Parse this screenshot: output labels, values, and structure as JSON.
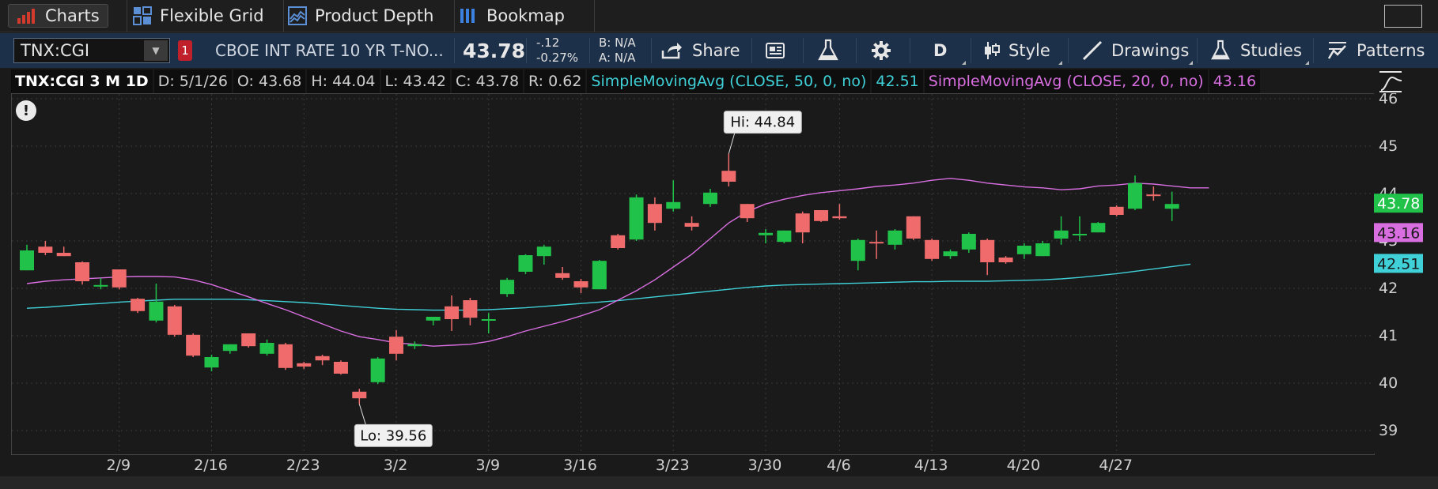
{
  "tabs": [
    {
      "label": "Charts",
      "icon": "bar-chart-icon",
      "active": true
    },
    {
      "label": "Flexible Grid",
      "icon": "grid-icon"
    },
    {
      "label": "Product Depth",
      "icon": "depth-icon"
    },
    {
      "label": "Bookmap",
      "icon": "bookmap-icon"
    }
  ],
  "toolbar": {
    "symbol": "TNX:CGI",
    "badge": "1",
    "description": "CBOE INT RATE 10 YR T-NO...",
    "last": "43.78",
    "change": "-.12",
    "change_pct": "-0.27%",
    "bid": "B: N/A",
    "ask": "A: N/A",
    "share_label": "Share",
    "period_label": "D",
    "style_label": "Style",
    "drawings_label": "Drawings",
    "studies_label": "Studies",
    "patterns_label": "Patterns"
  },
  "info": {
    "title": "TNX:CGI 3 M 1D",
    "date": "D: 5/1/26",
    "open": "O: 43.68",
    "high": "H: 44.04",
    "low": "L: 43.42",
    "close": "C: 43.78",
    "range": "R: 0.62",
    "sma50_label": "SimpleMovingAvg (CLOSE, 50, 0, no)",
    "sma50_value": "42.51",
    "sma20_label": "SimpleMovingAvg (CLOSE, 20, 0, no)",
    "sma20_value": "43.16"
  },
  "colors": {
    "up": "#21c24a",
    "down": "#f06b6b",
    "sma50": "#3fd0d8",
    "sma20": "#d86ee0",
    "grid": "#3a3a3a"
  },
  "chart_data": {
    "type": "candlestick",
    "ylim": [
      38.5,
      46.1
    ],
    "y_ticks": [
      39,
      40,
      41,
      42,
      43,
      44,
      45,
      46
    ],
    "x_labels": [
      {
        "label": "2/9",
        "index": 5
      },
      {
        "label": "2/16",
        "index": 10
      },
      {
        "label": "2/23",
        "index": 15
      },
      {
        "label": "3/2",
        "index": 20
      },
      {
        "label": "3/9",
        "index": 25
      },
      {
        "label": "3/16",
        "index": 30
      },
      {
        "label": "3/23",
        "index": 35
      },
      {
        "label": "3/30",
        "index": 40
      },
      {
        "label": "4/6",
        "index": 44
      },
      {
        "label": "4/13",
        "index": 49
      },
      {
        "label": "4/20",
        "index": 54
      },
      {
        "label": "4/27",
        "index": 59
      }
    ],
    "candles": [
      {
        "o": 42.38,
        "h": 42.92,
        "l": 42.38,
        "c": 42.8
      },
      {
        "o": 42.88,
        "h": 43.0,
        "l": 42.7,
        "c": 42.75
      },
      {
        "o": 42.75,
        "h": 42.88,
        "l": 42.68,
        "c": 42.68
      },
      {
        "o": 42.55,
        "h": 42.57,
        "l": 42.08,
        "c": 42.15
      },
      {
        "o": 42.07,
        "h": 42.22,
        "l": 41.98,
        "c": 42.07
      },
      {
        "o": 42.4,
        "h": 42.4,
        "l": 41.98,
        "c": 42.02
      },
      {
        "o": 41.78,
        "h": 41.8,
        "l": 41.48,
        "c": 41.52
      },
      {
        "o": 41.32,
        "h": 42.1,
        "l": 41.28,
        "c": 41.72
      },
      {
        "o": 41.62,
        "h": 41.65,
        "l": 40.98,
        "c": 41.02
      },
      {
        "o": 41.02,
        "h": 41.05,
        "l": 40.55,
        "c": 40.58
      },
      {
        "o": 40.33,
        "h": 40.6,
        "l": 40.25,
        "c": 40.55
      },
      {
        "o": 40.68,
        "h": 40.82,
        "l": 40.62,
        "c": 40.82
      },
      {
        "o": 41.05,
        "h": 41.05,
        "l": 40.75,
        "c": 40.78
      },
      {
        "o": 40.62,
        "h": 40.92,
        "l": 40.58,
        "c": 40.85
      },
      {
        "o": 40.82,
        "h": 40.85,
        "l": 40.28,
        "c": 40.32
      },
      {
        "o": 40.42,
        "h": 40.45,
        "l": 40.3,
        "c": 40.35
      },
      {
        "o": 40.57,
        "h": 40.6,
        "l": 40.38,
        "c": 40.48
      },
      {
        "o": 40.45,
        "h": 40.48,
        "l": 40.18,
        "c": 40.2
      },
      {
        "o": 39.82,
        "h": 39.88,
        "l": 39.56,
        "c": 39.68
      },
      {
        "o": 40.02,
        "h": 40.55,
        "l": 39.98,
        "c": 40.52
      },
      {
        "o": 40.98,
        "h": 41.12,
        "l": 40.48,
        "c": 40.62
      },
      {
        "o": 40.78,
        "h": 40.88,
        "l": 40.72,
        "c": 40.82
      },
      {
        "o": 41.32,
        "h": 41.4,
        "l": 41.22,
        "c": 41.4
      },
      {
        "o": 41.62,
        "h": 41.85,
        "l": 41.1,
        "c": 41.35
      },
      {
        "o": 41.75,
        "h": 41.8,
        "l": 41.22,
        "c": 41.38
      },
      {
        "o": 41.32,
        "h": 41.48,
        "l": 41.05,
        "c": 41.35
      },
      {
        "o": 41.88,
        "h": 42.22,
        "l": 41.82,
        "c": 42.18
      },
      {
        "o": 42.35,
        "h": 42.72,
        "l": 42.3,
        "c": 42.7
      },
      {
        "o": 42.68,
        "h": 42.92,
        "l": 42.5,
        "c": 42.88
      },
      {
        "o": 42.32,
        "h": 42.45,
        "l": 42.18,
        "c": 42.22
      },
      {
        "o": 42.15,
        "h": 42.2,
        "l": 41.9,
        "c": 42.02
      },
      {
        "o": 41.98,
        "h": 42.6,
        "l": 41.98,
        "c": 42.58
      },
      {
        "o": 43.12,
        "h": 43.15,
        "l": 42.82,
        "c": 42.85
      },
      {
        "o": 43.03,
        "h": 43.98,
        "l": 43.0,
        "c": 43.92
      },
      {
        "o": 43.78,
        "h": 43.92,
        "l": 43.22,
        "c": 43.38
      },
      {
        "o": 43.68,
        "h": 44.28,
        "l": 43.62,
        "c": 43.82
      },
      {
        "o": 43.38,
        "h": 43.52,
        "l": 43.22,
        "c": 43.3
      },
      {
        "o": 43.78,
        "h": 44.1,
        "l": 43.72,
        "c": 44.02
      },
      {
        "o": 44.48,
        "h": 44.84,
        "l": 44.15,
        "c": 44.25
      },
      {
        "o": 43.78,
        "h": 43.78,
        "l": 43.4,
        "c": 43.48
      },
      {
        "o": 43.12,
        "h": 43.25,
        "l": 42.95,
        "c": 43.17
      },
      {
        "o": 42.98,
        "h": 43.22,
        "l": 42.95,
        "c": 43.22
      },
      {
        "o": 43.58,
        "h": 43.62,
        "l": 42.95,
        "c": 43.18
      },
      {
        "o": 43.65,
        "h": 43.65,
        "l": 43.4,
        "c": 43.42
      },
      {
        "o": 43.52,
        "h": 43.78,
        "l": 43.45,
        "c": 43.48
      },
      {
        "o": 42.58,
        "h": 43.05,
        "l": 42.38,
        "c": 43.02
      },
      {
        "o": 42.98,
        "h": 43.22,
        "l": 42.62,
        "c": 42.95
      },
      {
        "o": 42.92,
        "h": 43.25,
        "l": 42.82,
        "c": 43.22
      },
      {
        "o": 43.52,
        "h": 43.52,
        "l": 43.02,
        "c": 43.05
      },
      {
        "o": 43.02,
        "h": 43.05,
        "l": 42.58,
        "c": 42.62
      },
      {
        "o": 42.68,
        "h": 42.82,
        "l": 42.62,
        "c": 42.78
      },
      {
        "o": 42.82,
        "h": 43.18,
        "l": 42.75,
        "c": 43.15
      },
      {
        "o": 43.02,
        "h": 43.05,
        "l": 42.28,
        "c": 42.55
      },
      {
        "o": 42.65,
        "h": 42.68,
        "l": 42.52,
        "c": 42.55
      },
      {
        "o": 42.72,
        "h": 42.95,
        "l": 42.62,
        "c": 42.9
      },
      {
        "o": 42.68,
        "h": 43.0,
        "l": 42.68,
        "c": 42.95
      },
      {
        "o": 43.05,
        "h": 43.52,
        "l": 42.92,
        "c": 43.22
      },
      {
        "o": 43.12,
        "h": 43.52,
        "l": 43.0,
        "c": 43.15
      },
      {
        "o": 43.18,
        "h": 43.4,
        "l": 43.18,
        "c": 43.38
      },
      {
        "o": 43.72,
        "h": 43.75,
        "l": 43.52,
        "c": 43.55
      },
      {
        "o": 43.68,
        "h": 44.38,
        "l": 43.65,
        "c": 44.22
      },
      {
        "o": 43.98,
        "h": 44.15,
        "l": 43.85,
        "c": 43.95
      },
      {
        "o": 43.68,
        "h": 44.04,
        "l": 43.42,
        "c": 43.78
      }
    ],
    "sma20": [
      42.1,
      42.15,
      42.18,
      42.2,
      42.22,
      42.24,
      42.25,
      42.25,
      42.24,
      42.18,
      42.08,
      41.95,
      41.82,
      41.68,
      41.55,
      41.4,
      41.25,
      41.1,
      40.98,
      40.92,
      40.85,
      40.82,
      40.78,
      40.8,
      40.82,
      40.88,
      40.98,
      41.1,
      41.2,
      41.3,
      41.42,
      41.55,
      41.75,
      41.95,
      42.18,
      42.45,
      42.72,
      43.05,
      43.38,
      43.62,
      43.78,
      43.88,
      43.96,
      44.02,
      44.06,
      44.1,
      44.15,
      44.18,
      44.22,
      44.28,
      44.32,
      44.28,
      44.22,
      44.18,
      44.14,
      44.12,
      44.08,
      44.1,
      44.16,
      44.18,
      44.22,
      44.2,
      44.16,
      44.12,
      44.12
    ],
    "sma50": [
      41.58,
      41.6,
      41.63,
      41.66,
      41.68,
      41.71,
      41.73,
      41.75,
      41.77,
      41.77,
      41.77,
      41.77,
      41.76,
      41.74,
      41.72,
      41.7,
      41.67,
      41.64,
      41.61,
      41.58,
      41.56,
      41.55,
      41.54,
      41.54,
      41.54,
      41.55,
      41.57,
      41.59,
      41.62,
      41.65,
      41.68,
      41.71,
      41.74,
      41.78,
      41.82,
      41.86,
      41.9,
      41.94,
      41.98,
      42.02,
      42.05,
      42.07,
      42.08,
      42.09,
      42.1,
      42.11,
      42.12,
      42.13,
      42.14,
      42.14,
      42.15,
      42.15,
      42.15,
      42.16,
      42.17,
      42.18,
      42.2,
      42.23,
      42.27,
      42.31,
      42.36,
      42.41,
      42.46,
      42.51
    ],
    "annotations": [
      {
        "label": "Hi: 44.84",
        "index": 38,
        "value": 44.84
      },
      {
        "label": "Lo: 39.56",
        "index": 18,
        "value": 39.56
      }
    ],
    "price_tags": [
      {
        "label": "43.78",
        "value": 43.78,
        "color": "#21c24a"
      },
      {
        "label": "43.16",
        "value": 43.16,
        "color": "#d86ee0"
      },
      {
        "label": "42.51",
        "value": 42.51,
        "color": "#3fd0d8"
      }
    ]
  }
}
